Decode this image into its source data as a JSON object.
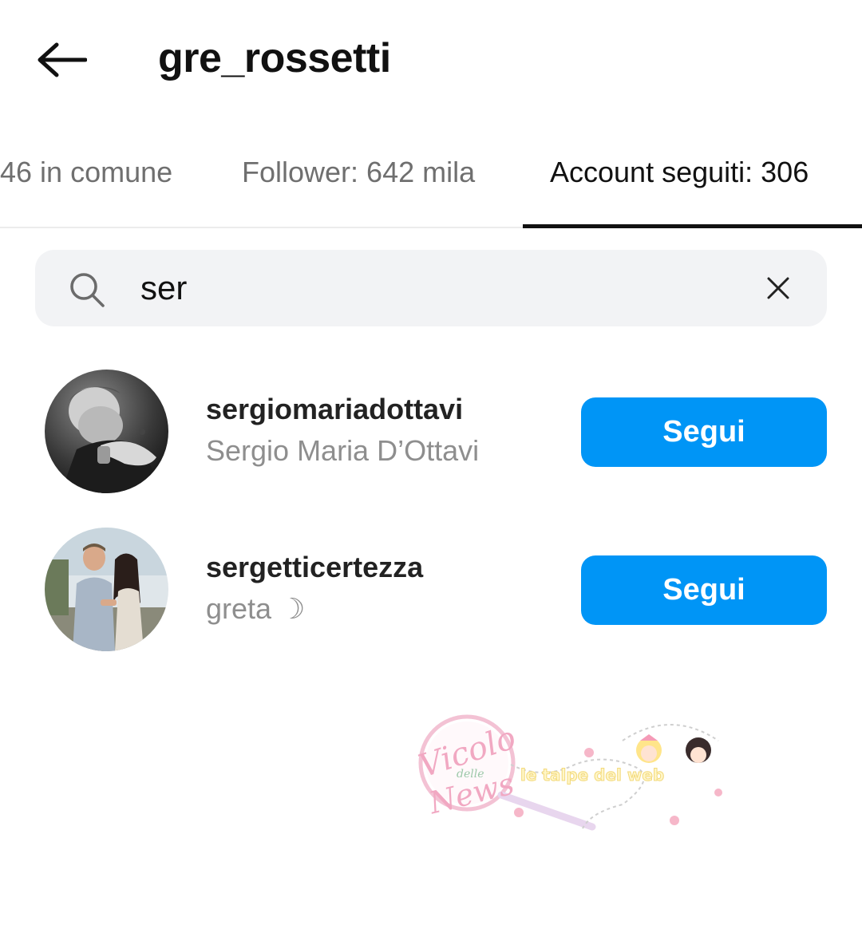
{
  "header": {
    "title": "gre_rossetti",
    "back_icon": "arrow-left-icon"
  },
  "tabs": [
    {
      "label": "46 in comune",
      "active": false
    },
    {
      "label": "Follower: 642 mila",
      "active": false
    },
    {
      "label": "Account seguiti: 306",
      "active": true
    }
  ],
  "search": {
    "value": "ser",
    "search_icon": "search-icon",
    "clear_icon": "close-icon"
  },
  "results": [
    {
      "username": "sergiomariadottavi",
      "full_name": "Sergio Maria D’Ottavi",
      "button_label": "Segui",
      "avatar_icon": "avatar-photo-bw"
    },
    {
      "username": "sergetticertezza",
      "full_name": "greta ☽",
      "button_label": "Segui",
      "avatar_icon": "avatar-photo-color"
    }
  ],
  "watermark": {
    "logo_title": "Vicolo",
    "logo_middle": "delle",
    "logo_bottom": "News",
    "tagline": "le talpe del web"
  },
  "colors": {
    "accent": "#0095f6",
    "secondary_text": "#8e8e8e",
    "search_bg": "#f2f3f5"
  }
}
